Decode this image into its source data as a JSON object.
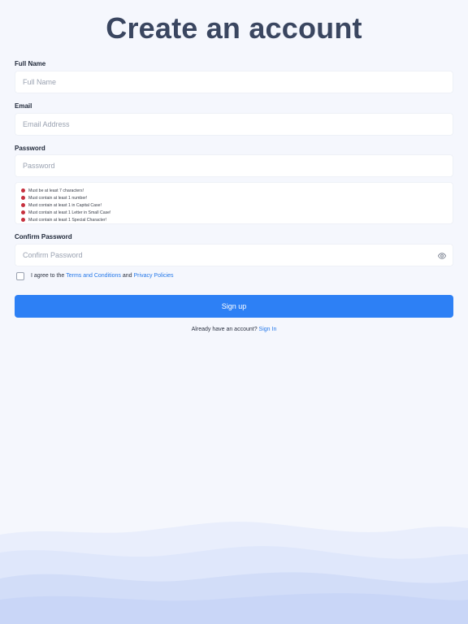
{
  "title": "Create an account",
  "full_name": {
    "label": "Full Name",
    "placeholder": "Full Name"
  },
  "email": {
    "label": "Email",
    "placeholder": "Email Address"
  },
  "password": {
    "label": "Password",
    "placeholder": "Password",
    "rules": [
      "Must be at least 7 characters!",
      "Must contain at least 1 number!",
      "Must contain at least 1 in Capital Case!",
      "Must contain at least 1 Letter in Small Case!",
      "Must contain at least 1 Special Character!"
    ]
  },
  "confirm_password": {
    "label": "Confirm Password",
    "placeholder": "Confirm Password"
  },
  "agree": {
    "prefix": "I agree to the",
    "terms_link": "Terms and Conditions",
    "middle": "and",
    "privacy_link": "Privacy Policies"
  },
  "signup_button": "Sign up",
  "signin": {
    "prompt": "Already have an account?",
    "link": "Sign In"
  },
  "colors": {
    "background": "#f5f7fd",
    "primary": "#2d80f5",
    "link": "#2578e9",
    "error": "#c6303e",
    "title": "#3a4660"
  },
  "icons": {
    "password_rule": "error-dot-icon",
    "toggle_visibility": "eye-icon"
  }
}
